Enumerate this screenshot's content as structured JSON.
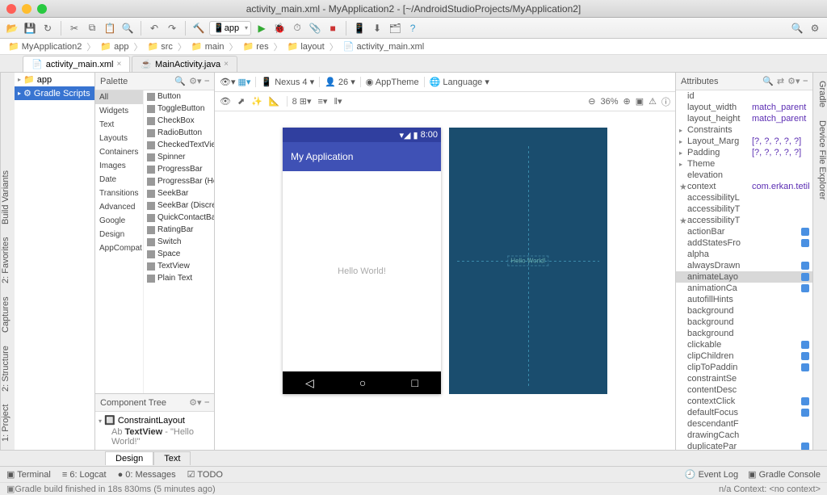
{
  "window": {
    "title": "activity_main.xml - MyApplication2 - [~/AndroidStudioProjects/MyApplication2]"
  },
  "toolbar": {
    "run_config": "app"
  },
  "breadcrumb": [
    "MyApplication2",
    "app",
    "src",
    "main",
    "res",
    "layout",
    "activity_main.xml"
  ],
  "file_tabs": [
    {
      "name": "activity_main.xml",
      "active": true
    },
    {
      "name": "MainActivity.java",
      "active": false
    }
  ],
  "side_left": [
    "1: Project",
    "2: Structure",
    "Captures",
    "2: Favorites",
    "Build Variants"
  ],
  "side_right": [
    "Gradle",
    "Device File Explorer"
  ],
  "project_tree": {
    "root": "app",
    "selected": "Gradle Scripts"
  },
  "palette": {
    "title": "Palette",
    "categories": [
      "All",
      "Widgets",
      "Text",
      "Layouts",
      "Containers",
      "Images",
      "Date",
      "Transitions",
      "Advanced",
      "Google",
      "Design",
      "AppCompat"
    ],
    "selected_cat": "All",
    "items": [
      "Button",
      "ToggleButton",
      "CheckBox",
      "RadioButton",
      "CheckedTextView",
      "Spinner",
      "ProgressBar",
      "ProgressBar (Ho",
      "SeekBar",
      "SeekBar (Discret",
      "QuickContactBa",
      "RatingBar",
      "Switch",
      "Space",
      "TextView",
      "Plain Text"
    ]
  },
  "component_tree": {
    "title": "Component Tree",
    "root": "ConstraintLayout",
    "child": "TextView",
    "child_text": "\"Hello World!\""
  },
  "design_bar": {
    "device": "Nexus 4",
    "api": "26",
    "theme": "AppTheme",
    "lang": "Language",
    "zoom": "36%",
    "margin": "8"
  },
  "phone": {
    "time": "8:00",
    "app_title": "My Application",
    "hello": "Hello World!"
  },
  "blueprint_label": "Hello World!",
  "attributes": {
    "title": "Attributes",
    "rows": [
      {
        "k": "id",
        "v": ""
      },
      {
        "k": "layout_width",
        "v": "match_parent"
      },
      {
        "k": "layout_height",
        "v": "match_parent"
      },
      {
        "k": "Constraints",
        "v": "",
        "exp": true
      },
      {
        "k": "Layout_Marg",
        "v": "[?, ?, ?, ?, ?]",
        "exp": true
      },
      {
        "k": "Padding",
        "v": "[?, ?, ?, ?, ?]",
        "exp": true
      },
      {
        "k": "Theme",
        "v": "",
        "exp": true
      },
      {
        "k": "elevation",
        "v": ""
      },
      {
        "k": "context",
        "v": "com.erkan.tetik.m",
        "star": true
      },
      {
        "k": "accessibilityL",
        "v": ""
      },
      {
        "k": "accessibilityT",
        "v": ""
      },
      {
        "k": "accessibilityT",
        "v": "",
        "star": true
      },
      {
        "k": "actionBar",
        "v": "",
        "flag": true
      },
      {
        "k": "addStatesFro",
        "v": "",
        "flag": true
      },
      {
        "k": "alpha",
        "v": ""
      },
      {
        "k": "alwaysDrawn",
        "v": "",
        "flag": true
      },
      {
        "k": "animateLayo",
        "v": "",
        "flag": true,
        "sel": true
      },
      {
        "k": "animationCa",
        "v": "",
        "flag": true
      },
      {
        "k": "autofillHints",
        "v": ""
      },
      {
        "k": "background",
        "v": ""
      },
      {
        "k": "background",
        "v": ""
      },
      {
        "k": "background",
        "v": ""
      },
      {
        "k": "clickable",
        "v": "",
        "flag": true
      },
      {
        "k": "clipChildren",
        "v": "",
        "flag": true
      },
      {
        "k": "clipToPaddin",
        "v": "",
        "flag": true
      },
      {
        "k": "constraintSe",
        "v": ""
      },
      {
        "k": "contentDesc",
        "v": ""
      },
      {
        "k": "contextClick",
        "v": "",
        "flag": true
      },
      {
        "k": "defaultFocus",
        "v": "",
        "flag": true
      },
      {
        "k": "descendantF",
        "v": ""
      },
      {
        "k": "drawingCach",
        "v": ""
      },
      {
        "k": "duplicatePar",
        "v": "",
        "flag": true
      }
    ]
  },
  "design_tabs": [
    "Design",
    "Text"
  ],
  "bottom": {
    "items": [
      "Terminal",
      "6: Logcat",
      "0: Messages",
      "TODO"
    ],
    "right": [
      "Event Log",
      "Gradle Console"
    ]
  },
  "status": {
    "msg": "Gradle build finished in 18s 830ms (5 minutes ago)",
    "right": "n/a   Context: <no context>"
  }
}
